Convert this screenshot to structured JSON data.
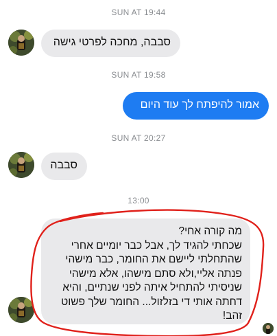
{
  "conversation": {
    "timestamps": [
      "SUN AT 19:44",
      "SUN AT 19:58",
      "SUN AT 20:27",
      "13:00"
    ],
    "messages": [
      {
        "text": "סבבה, מחכה לפרטי גישה"
      },
      {
        "text": "אמור להיפתח לך עוד היום"
      },
      {
        "text": "סבבה"
      },
      {
        "text": "מה קורה אחי?\nשכחתי להגיד לך, אבל כבר יומיים אחרי שהתחלתי ליישם את החומר, כבר מישהי פנתה אליי,ולא סתם מישהו, אלא מישהי שניסיתי להתחיל איתה לפני שנתיים, והיא דחתה אותי די בזלזול... החומר שלך פשוט זהב!"
      }
    ]
  },
  "colors": {
    "incoming_bubble": "#e9e9eb",
    "outgoing_bubble": "#1e7cf2",
    "timestamp": "#8a8d91",
    "annotation_circle": "#e0211b"
  },
  "icons": {
    "contact_avatar": "contact-avatar-icon",
    "read_receipt": "read-receipt-avatar-icon"
  }
}
